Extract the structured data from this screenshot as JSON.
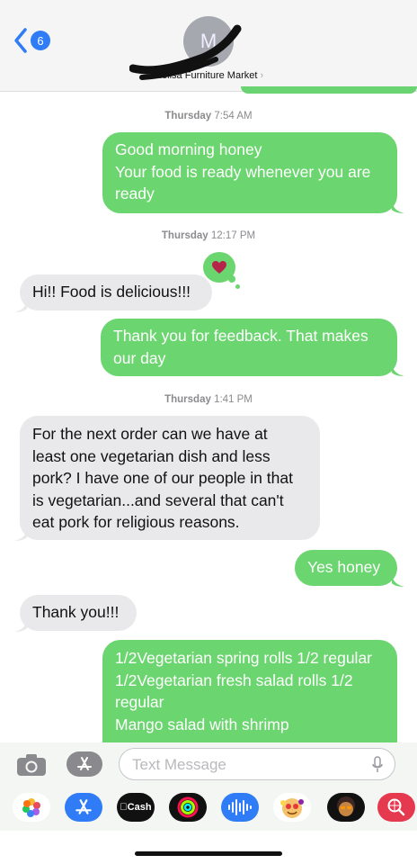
{
  "header": {
    "back_count": "6",
    "avatar_initial": "M",
    "contact_name": "Melisa Furniture Market"
  },
  "messages": [
    {
      "type": "timestamp",
      "day": "Thursday",
      "time": "7:54 AM"
    },
    {
      "type": "outgoing",
      "lines": [
        "Good morning honey",
        "Your food is ready whenever you are",
        "ready"
      ]
    },
    {
      "type": "timestamp",
      "day": "Thursday",
      "time": "12:17 PM"
    },
    {
      "type": "incoming",
      "lines": [
        "Hi!! Food is delicious!!!"
      ],
      "tapback": "heart-icon"
    },
    {
      "type": "outgoing",
      "lines": [
        "Thank you for feedback. That makes",
        "our day"
      ]
    },
    {
      "type": "timestamp",
      "day": "Thursday",
      "time": "1:41 PM"
    },
    {
      "type": "incoming",
      "lines": [
        "For the next order can we have at",
        "least one vegetarian dish and less",
        "pork? I have one of our people in that",
        "is vegetarian...and several that can't",
        "eat pork for religious reasons."
      ]
    },
    {
      "type": "outgoing",
      "lines": [
        "Yes honey"
      ]
    },
    {
      "type": "incoming",
      "lines": [
        "Thank you!!!"
      ]
    },
    {
      "type": "outgoing",
      "lines": [
        "1/2Vegetarian spring rolls 1/2 regular",
        "1/2Vegetarian fresh salad rolls 1/2",
        "regular",
        "Mango salad with shrimp"
      ]
    }
  ],
  "input": {
    "placeholder": "Text Message"
  },
  "apps": [
    {
      "name": "photos-icon"
    },
    {
      "name": "app-store-icon"
    },
    {
      "name": "cash-icon",
      "label": "Cash"
    },
    {
      "name": "activity-icon"
    },
    {
      "name": "audio-message-icon"
    },
    {
      "name": "memoji-icon"
    },
    {
      "name": "memoji-stickers-icon"
    },
    {
      "name": "image-search-icon"
    }
  ],
  "colors": {
    "outgoing": "#6bd56f",
    "incoming": "#e9e9eb",
    "accent": "#2f7cf6",
    "heart": "#b5254a"
  }
}
